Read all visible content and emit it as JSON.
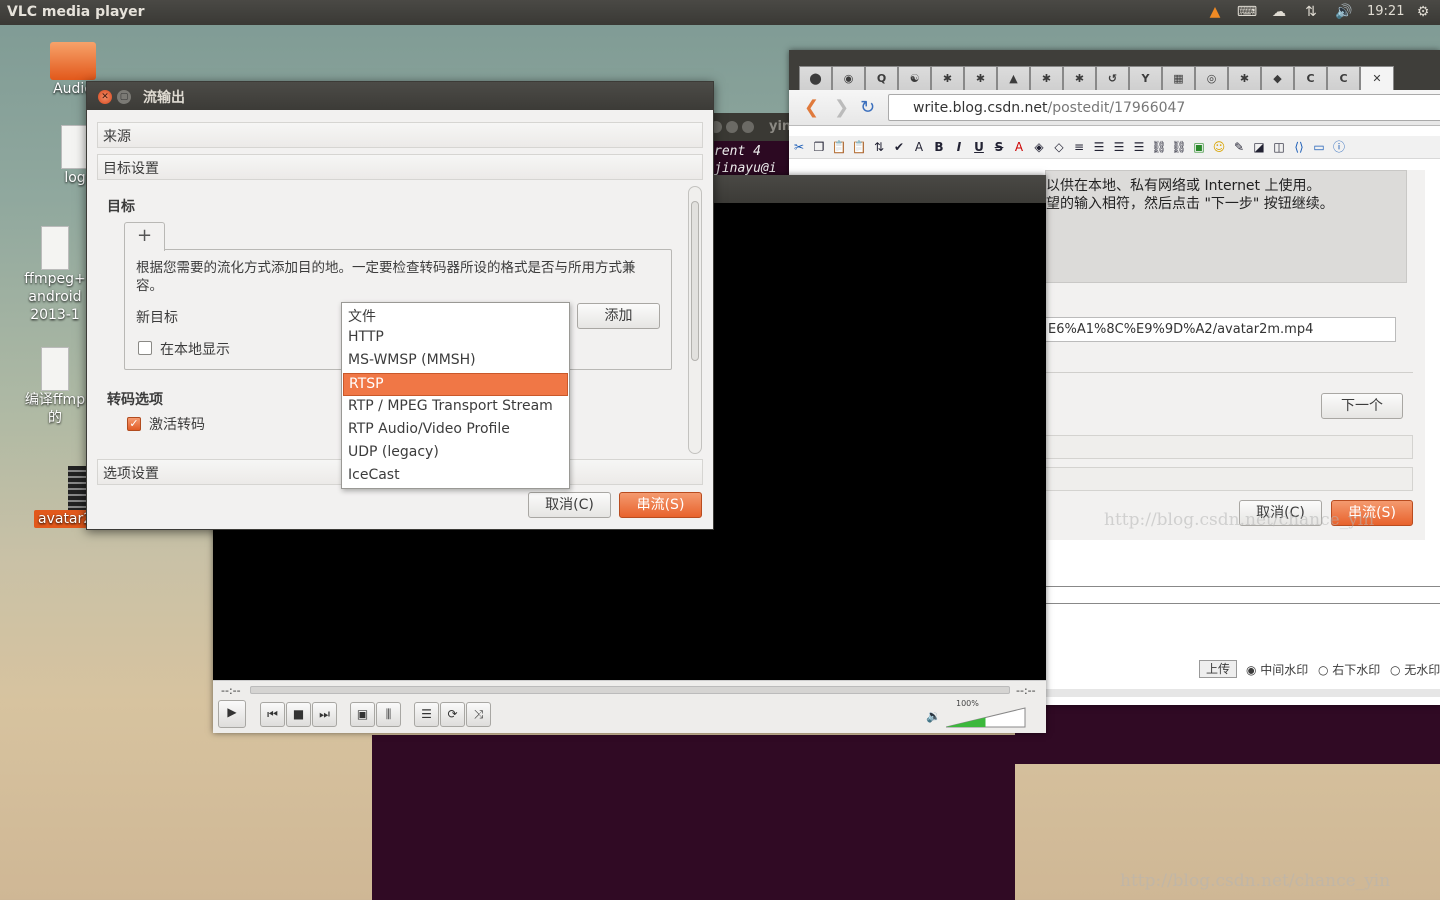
{
  "topbar": {
    "app_title": "VLC media player",
    "time": "19:21",
    "icons": [
      "vlc-cone-icon",
      "keyboard-icon",
      "cloud-icon",
      "network-icon",
      "volume-icon",
      "gear-icon"
    ]
  },
  "desktop": {
    "icons": [
      {
        "label": "Audio",
        "icon": "folder-icon"
      },
      {
        "label": "log",
        "icon": "document-icon"
      },
      {
        "label": "ffmpeg+\nandroid\n2013-1",
        "icon": "document-icon"
      },
      {
        "label": "编译ffmp\n的",
        "icon": "document-icon"
      },
      {
        "label": "avatar2m.mp4",
        "icon": "video-file-icon"
      }
    ]
  },
  "terminal": {
    "title": "yin",
    "line1": "rent 4",
    "line2": "jinayu@i"
  },
  "browser": {
    "url_host": "write.blog.csdn.net",
    "url_path": "/postedit/17966047",
    "tab_count": 18,
    "wizard": {
      "info_line1": "以供在本地、私有网络或 Internet 上使用。",
      "info_line2": "望的输入相符，然后点击 \"下一步\" 按钮继续。",
      "source_url": "E6%A1%8C%E9%9D%A2/avatar2m.mp4",
      "next_label": "下一个",
      "cancel_label": "取消(C)",
      "stream_label": "串流(S)"
    },
    "upload": {
      "upload_label": "上传",
      "radio1": "中间水印",
      "radio2": "右下水印",
      "radio3": "无水印"
    },
    "watermark": "http://blog.csdn.net/chance_yin"
  },
  "vlc": {
    "time_elapsed": "--:--",
    "time_total": "--:--",
    "volume": "100%",
    "volume_level": 1.0
  },
  "dialog": {
    "title": "流输出",
    "section_source": "来源",
    "section_dest": "目标设置",
    "target_heading": "目标",
    "add_tab": "+",
    "description": "根据您需要的流化方式添加目的地。一定要检查转码器所设的格式是否与所用方式兼容。",
    "new_target_label": "新目标",
    "add_button": "添加",
    "display_locally": "在本地显示",
    "display_locally_checked": false,
    "transcode_heading": "转码选项",
    "activate_transcode": "激活转码",
    "activate_transcode_checked": true,
    "section_options": "选项设置",
    "cancel_button": "取消(C)",
    "stream_button": "串流(S)",
    "dropdown": {
      "options": [
        "文件",
        "HTTP",
        "MS-WMSP (MMSH)",
        "RTSP",
        "RTP / MPEG Transport Stream",
        "RTP Audio/Video Profile",
        "UDP (legacy)",
        "IceCast"
      ],
      "selected": "RTSP"
    }
  }
}
